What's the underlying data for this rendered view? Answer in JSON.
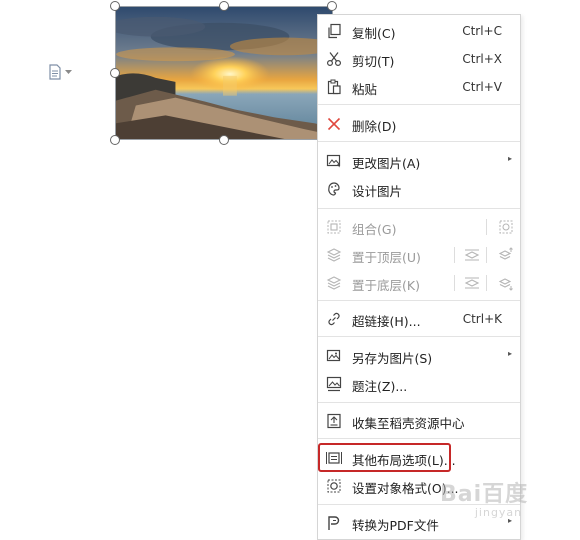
{
  "menu": {
    "items": [
      {
        "label": "复制(C)",
        "shortcut": "Ctrl+C",
        "icon": "copy-icon"
      },
      {
        "label": "剪切(T)",
        "shortcut": "Ctrl+X",
        "icon": "scissors-icon"
      },
      {
        "label": "粘贴",
        "shortcut": "Ctrl+V",
        "icon": "paste-icon"
      },
      {
        "label": "删除(D)",
        "icon": "delete-x-icon"
      },
      {
        "label": "更改图片(A)",
        "icon": "change-image-icon",
        "submenu": true
      },
      {
        "label": "设计图片",
        "icon": "design-image-icon"
      },
      {
        "label": "组合(G)",
        "icon": "group-icon",
        "disabled": true
      },
      {
        "label": "置于顶层(U)",
        "icon": "bring-to-front-icon",
        "disabled": true
      },
      {
        "label": "置于底层(K)",
        "icon": "send-to-back-icon",
        "disabled": true
      },
      {
        "label": "超链接(H)...",
        "shortcut": "Ctrl+K",
        "icon": "link-icon"
      },
      {
        "label": "另存为图片(S)",
        "icon": "save-image-icon",
        "submenu": true
      },
      {
        "label": "题注(Z)...",
        "icon": "caption-icon"
      },
      {
        "label": "收集至稻壳资源中心",
        "icon": "collect-icon"
      },
      {
        "label": "其他布局选项(L)...",
        "icon": "layout-options-icon",
        "highlighted": true
      },
      {
        "label": "设置对象格式(O)...",
        "icon": "format-object-icon"
      },
      {
        "label": "转换为PDF文件",
        "icon": "pdf-icon",
        "submenu": true
      }
    ],
    "submenu_glyph": "▸"
  },
  "watermark": {
    "text": "Bai百度",
    "sub": "jingyan"
  },
  "colors": {
    "highlight_border": "#c62828",
    "delete_icon": "#e0483e"
  }
}
